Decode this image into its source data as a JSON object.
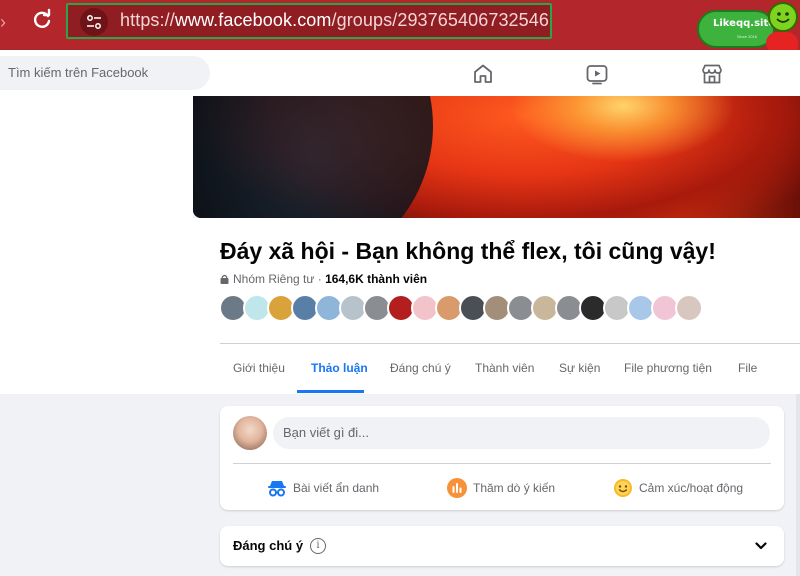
{
  "browser": {
    "url_prefix": "https://",
    "url_domain": "www.facebook.com",
    "url_path": "/groups/293765406732546",
    "watermark": "Likeqq.site",
    "watermark_sub": "Since 2016"
  },
  "header": {
    "search_placeholder": "Tìm kiếm trên Facebook",
    "nav_icons": [
      "home-icon",
      "watch-icon",
      "marketplace-icon"
    ]
  },
  "group": {
    "title": "Đáy xã hội - Bạn không thể flex, tôi cũng vậy!",
    "privacy": "Nhóm Riêng tư",
    "separator": " · ",
    "member_count": "164,6K thành viên"
  },
  "tabs": [
    {
      "label": "Giới thiệu",
      "active": false
    },
    {
      "label": "Thảo luận",
      "active": true
    },
    {
      "label": "Đáng chú ý",
      "active": false
    },
    {
      "label": "Thành viên",
      "active": false
    },
    {
      "label": "Sự kiện",
      "active": false
    },
    {
      "label": "File phương tiện",
      "active": false
    },
    {
      "label": "File",
      "active": false
    }
  ],
  "composer": {
    "placeholder": "Bạn viết gì đi...",
    "actions": [
      {
        "label": "Bài viết ẩn danh",
        "icon": "anonymous-icon",
        "color": "#1877f2"
      },
      {
        "label": "Thăm dò ý kiến",
        "icon": "poll-icon",
        "color": "#f7923a"
      },
      {
        "label": "Cảm xúc/hoạt động",
        "icon": "feeling-icon",
        "color": "#f7b928"
      }
    ]
  },
  "attention": {
    "title": "Đáng chú ý"
  },
  "colors": {
    "browser_bar": "#b3262b",
    "accent": "#1877f2",
    "url_border": "#2aa64a"
  }
}
